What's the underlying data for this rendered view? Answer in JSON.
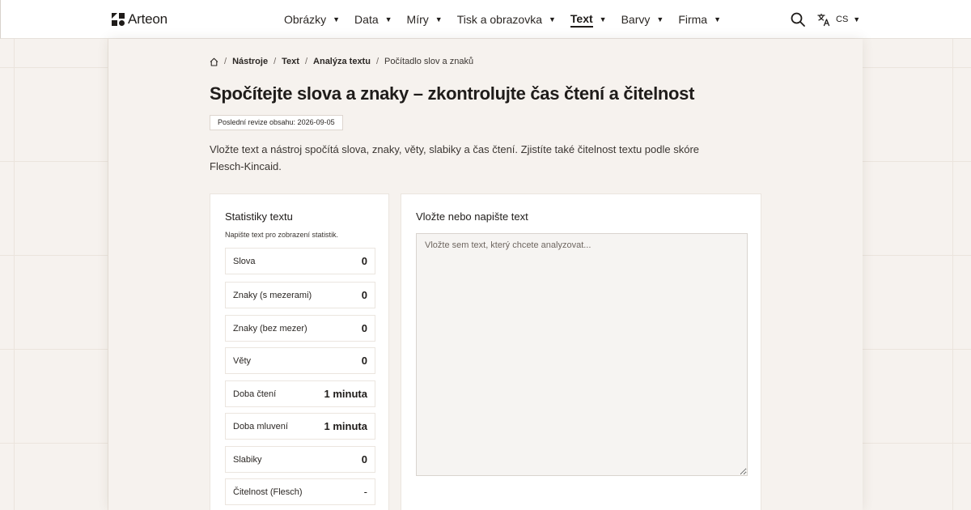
{
  "brand": {
    "name": "Arteon"
  },
  "nav": {
    "items": [
      {
        "label": "Obrázky"
      },
      {
        "label": "Data"
      },
      {
        "label": "Míry"
      },
      {
        "label": "Tisk a obrazovka"
      },
      {
        "label": "Text",
        "active": true
      },
      {
        "label": "Barvy"
      },
      {
        "label": "Firma"
      }
    ],
    "language": "CS"
  },
  "breadcrumb": {
    "items": [
      "Nástroje",
      "Text",
      "Analýza textu"
    ],
    "current": "Počítadlo slov a znaků"
  },
  "page": {
    "title": "Spočítejte slova a znaky – zkontrolujte čas čtení a čitelnost",
    "revision": "Poslední revize obsahu: 2026-09-05",
    "intro": "Vložte text a nástroj spočítá slova, znaky, věty, slabiky a čas čtení. Zjistíte také čitelnost textu podle skóre Flesch-Kincaid."
  },
  "stats": {
    "title": "Statistiky textu",
    "hint": "Napište text pro zobrazení statistik.",
    "rows": [
      {
        "label": "Slova",
        "value": "0"
      },
      {
        "label": "Znaky (s mezerami)",
        "value": "0"
      },
      {
        "label": "Znaky (bez mezer)",
        "value": "0"
      },
      {
        "label": "Věty",
        "value": "0"
      },
      {
        "label": "Doba čtení",
        "value": "1 minuta"
      },
      {
        "label": "Doba mluvení",
        "value": "1 minuta"
      },
      {
        "label": "Slabiky",
        "value": "0"
      },
      {
        "label": "Čitelnost (Flesch)",
        "value": "-"
      }
    ]
  },
  "editor": {
    "title": "Vložte nebo napište text",
    "placeholder": "Vložte sem text, který chcete analyzovat...",
    "value": ""
  },
  "icons": {
    "logo": "arteon-logo-icon",
    "search": "search-icon",
    "translate": "translate-icon",
    "home": "home-icon",
    "caret": "caret-down-icon"
  }
}
